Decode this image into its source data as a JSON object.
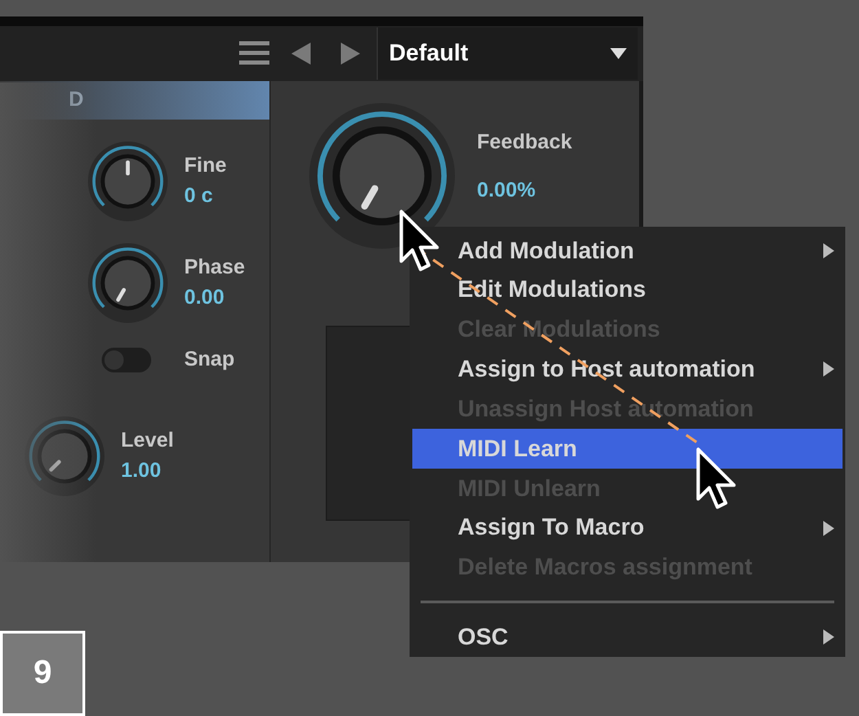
{
  "toolbar": {
    "preset": "Default"
  },
  "section_header": "D",
  "controls": [
    {
      "kind": "knob",
      "label": "Fine",
      "value": "0 c"
    },
    {
      "kind": "knob",
      "label": "Phase",
      "value": "0.00"
    },
    {
      "kind": "toggle",
      "label": "Snap",
      "on": false
    },
    {
      "kind": "knob",
      "label": "Level",
      "value": "1.00"
    }
  ],
  "feedback": {
    "label": "Feedback",
    "value": "0.00%"
  },
  "context_menu": [
    {
      "kind": "item",
      "label": "Add Modulation",
      "disabled": false,
      "submenu": true,
      "selected": false
    },
    {
      "kind": "item",
      "label": "Edit Modulations",
      "disabled": false,
      "submenu": false,
      "selected": false
    },
    {
      "kind": "item",
      "label": "Clear Modulations",
      "disabled": true,
      "submenu": false,
      "selected": false
    },
    {
      "kind": "item",
      "label": "Assign to Host automation",
      "disabled": false,
      "submenu": true,
      "selected": false
    },
    {
      "kind": "item",
      "label": "Unassign Host automation",
      "disabled": true,
      "submenu": false,
      "selected": false
    },
    {
      "kind": "item",
      "label": "MIDI Learn",
      "disabled": false,
      "submenu": false,
      "selected": true
    },
    {
      "kind": "item",
      "label": "MIDI Unlearn",
      "disabled": true,
      "submenu": false,
      "selected": false
    },
    {
      "kind": "item",
      "label": "Assign To Macro",
      "disabled": false,
      "submenu": true,
      "selected": false
    },
    {
      "kind": "item",
      "label": "Delete Macros assignment",
      "disabled": true,
      "submenu": false,
      "selected": false
    },
    {
      "kind": "separator"
    },
    {
      "kind": "item",
      "label": "OSC",
      "disabled": false,
      "submenu": true,
      "selected": false
    }
  ],
  "step_badge": "9"
}
